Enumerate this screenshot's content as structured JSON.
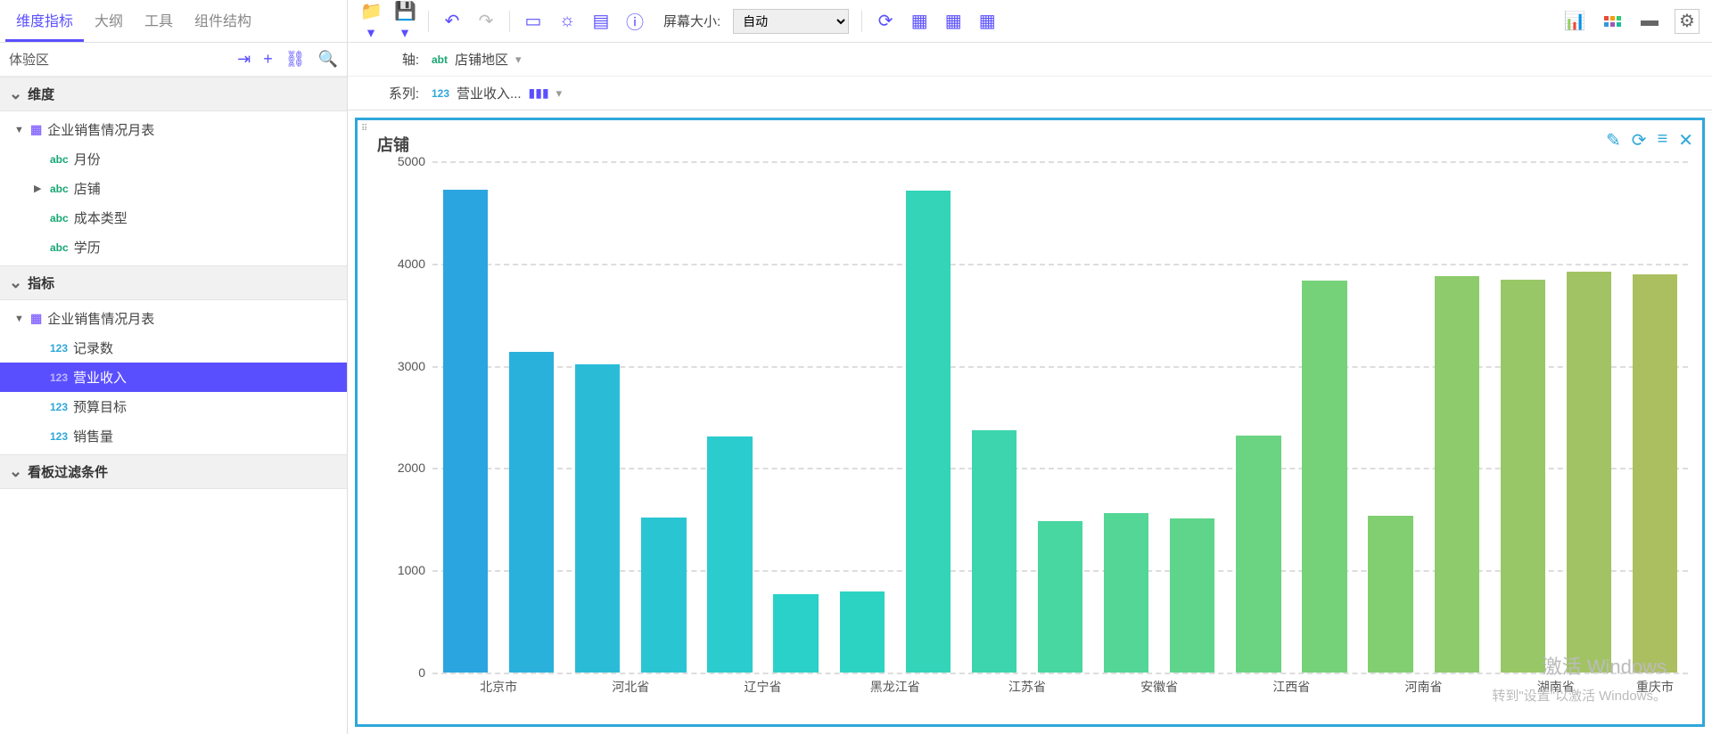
{
  "sidebar": {
    "tabs": [
      "维度指标",
      "大纲",
      "工具",
      "组件结构"
    ],
    "experience_label": "体验区",
    "sections": {
      "dimension_label": "维度",
      "metric_label": "指标",
      "filter_label": "看板过滤条件"
    },
    "dim_table": "企业销售情况月表",
    "dim_fields": [
      "月份",
      "店铺",
      "成本类型",
      "学历"
    ],
    "metric_table": "企业销售情况月表",
    "metric_fields": [
      "记录数",
      "营业收入",
      "预算目标",
      "销售量"
    ],
    "selected_metric_index": 1
  },
  "toolbar": {
    "screen_label": "屏幕大小:",
    "screen_value": "自动"
  },
  "config": {
    "axis_label": "轴:",
    "axis_field": "店铺地区",
    "series_label": "系列:",
    "series_field": "营业收入..."
  },
  "chart": {
    "title": "店铺"
  },
  "watermark": {
    "line1": "激活 Windows",
    "line2": "转到\"设置\"以激活 Windows。"
  },
  "chart_data": {
    "type": "bar",
    "title": "店铺",
    "xlabel": "",
    "ylabel": "",
    "ylim": [
      0,
      5000
    ],
    "yticks": [
      0,
      1000,
      2000,
      3000,
      4000,
      5000
    ],
    "series_name": "营业收入",
    "x_major_labels": [
      "北京市",
      "河北省",
      "辽宁省",
      "黑龙江省",
      "江苏省",
      "安徽省",
      "江西省",
      "河南省",
      "湖南省",
      "重庆市"
    ],
    "values": [
      4720,
      3140,
      3010,
      1520,
      2310,
      770,
      790,
      4710,
      2370,
      1480,
      1560,
      1510,
      2320,
      3830,
      1530,
      3880,
      3840,
      3920,
      3890
    ],
    "colors": [
      "#2aa5e0",
      "#2ab1db",
      "#2abcd7",
      "#2ac5d2",
      "#2accce",
      "#2ad1c9",
      "#2dd3c2",
      "#33d4b8",
      "#3dd5ad",
      "#48d6a1",
      "#53d696",
      "#5ed58b",
      "#6ad482",
      "#76d279",
      "#82cf72",
      "#8dcb6c",
      "#98c767",
      "#a2c364",
      "#abbf61"
    ]
  }
}
